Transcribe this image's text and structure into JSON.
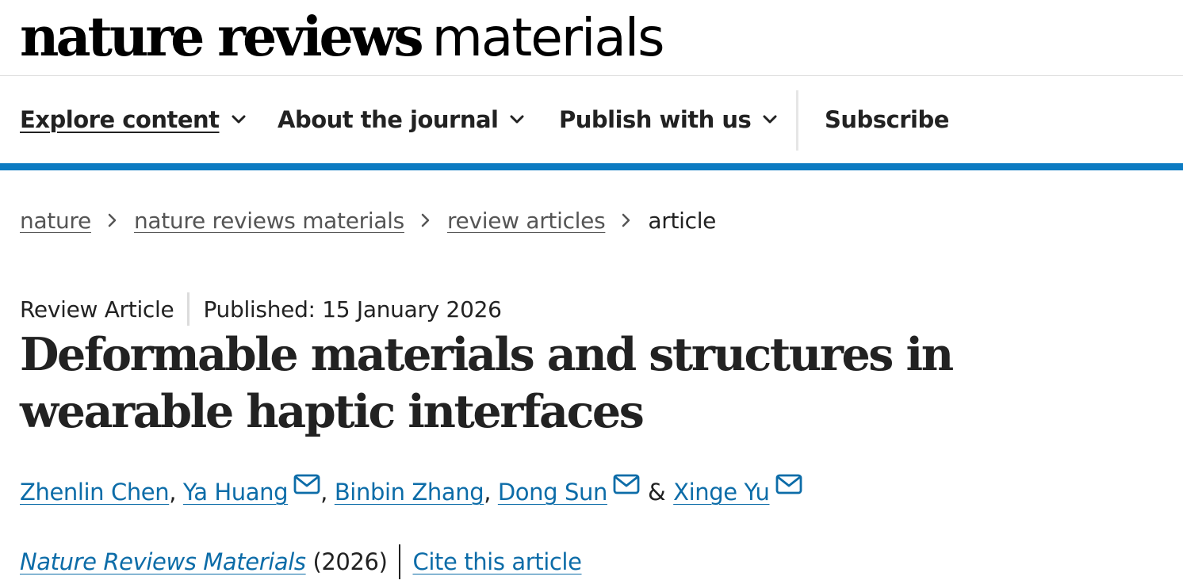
{
  "header": {
    "logo_bold": "nature reviews",
    "logo_light": "materials"
  },
  "nav": {
    "items": [
      {
        "label": "Explore content",
        "icon": "chevron-down-icon"
      },
      {
        "label": "About the journal",
        "icon": "chevron-down-icon"
      },
      {
        "label": "Publish with us",
        "icon": "chevron-down-icon"
      },
      {
        "label": "Subscribe"
      }
    ],
    "accent_color": "#0c7bc2"
  },
  "breadcrumb": {
    "items": [
      "nature",
      "nature reviews materials",
      "review articles"
    ],
    "current": "article"
  },
  "article": {
    "type": "Review Article",
    "published": "Published: 15 January 2026",
    "title": "Deformable materials and structures in wearable haptic interfaces",
    "authors": [
      {
        "name": "Zhenlin Chen",
        "email_icon": false
      },
      {
        "name": "Ya Huang",
        "email_icon": true
      },
      {
        "name": "Binbin Zhang",
        "email_icon": false
      },
      {
        "name": "Dong Sun",
        "email_icon": true
      },
      {
        "name": "Xinge Yu",
        "email_icon": true
      }
    ],
    "author_separator": ",",
    "author_last_separator": "&",
    "journal": "Nature Reviews Materials",
    "year": "(2026)",
    "cite_label": "Cite this article",
    "link_color": "#0c6ca8"
  }
}
